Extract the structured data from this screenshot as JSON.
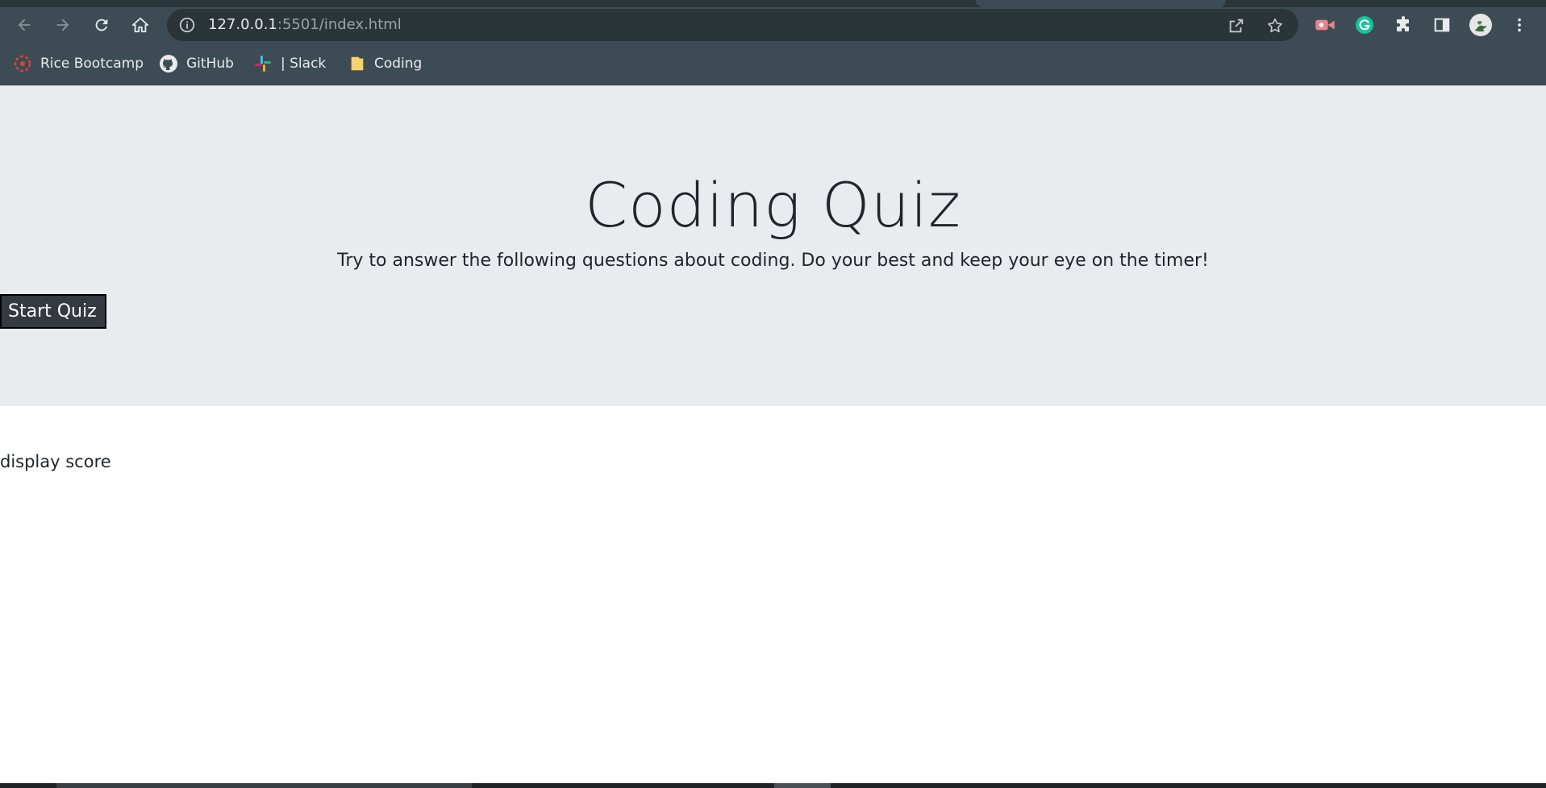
{
  "browser": {
    "url_host": "127.0.0.1",
    "url_path": ":5501/index.html",
    "nav": {
      "back": "back-arrow-icon",
      "forward": "forward-arrow-icon",
      "reload": "reload-icon",
      "home": "home-icon"
    },
    "bookmarks": [
      {
        "label": "Rice Bootcamp",
        "icon": "rice-bootcamp-icon"
      },
      {
        "label": "GitHub",
        "icon": "github-icon"
      },
      {
        "label": "| Slack",
        "icon": "slack-icon"
      },
      {
        "label": "Coding",
        "icon": "folder-icon"
      }
    ],
    "extensions": [
      "video-extension-icon",
      "grammarly-icon",
      "puzzle-extensions-icon",
      "side-panel-icon",
      "profile-avatar",
      "menu-kebab-icon"
    ]
  },
  "page": {
    "title": "Coding Quiz",
    "subtitle": "Try to answer the following questions about coding. Do your best and keep your eye on the timer!",
    "start_button": "Start Quiz",
    "score_text": "display score"
  },
  "colors": {
    "chrome_toolbar": "#3d4c54",
    "omnibox": "#2b3439",
    "jumbotron": "#e9ecef",
    "button_bg": "#343a40",
    "text": "#212529"
  }
}
